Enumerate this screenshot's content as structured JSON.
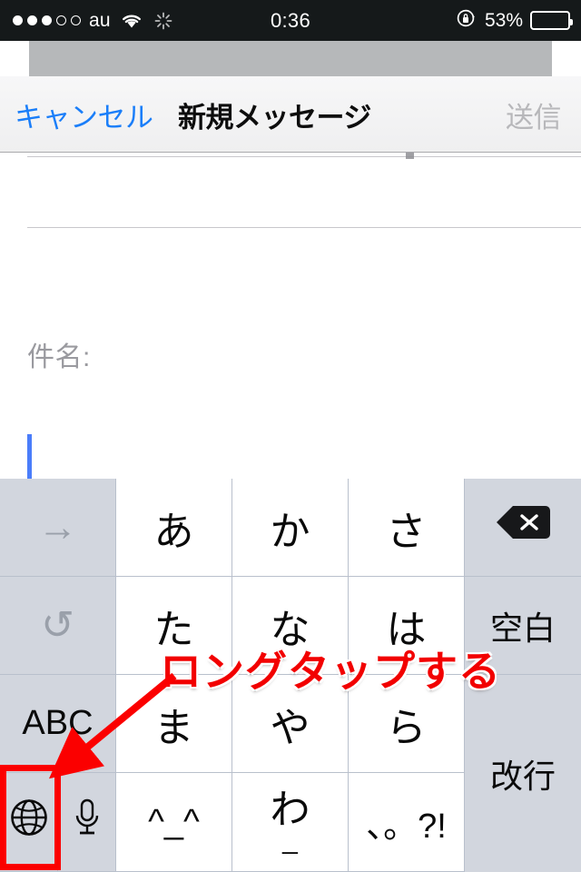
{
  "status_bar": {
    "signal_dots_total": 5,
    "signal_dots_filled": 3,
    "carrier": "au",
    "wifi_icon": "wifi-icon",
    "activity_icon": "activity-spinner-icon",
    "time": "0:36",
    "rotation_lock_icon": "rotation-lock-icon",
    "battery_percent": "53%",
    "battery_level": 53,
    "background_color": "#15191a",
    "text_color": "#ffffff"
  },
  "nav_bar": {
    "cancel_label": "キャンセル",
    "title": "新規メッセージ",
    "send_label": "送信",
    "cancel_color": "#1a7ef9",
    "send_color": "#b7b7ba"
  },
  "compose": {
    "subject_placeholder": "件名:",
    "body_value": "",
    "caret_color": "#4a7dfa"
  },
  "keyboard": {
    "type": "japanese-kana-12key",
    "rows": [
      [
        {
          "name": "next-candidate-key",
          "label": "→",
          "style": "fn-dim"
        },
        {
          "name": "key-a",
          "label": "あ",
          "style": "main"
        },
        {
          "name": "key-ka",
          "label": "か",
          "style": "main"
        },
        {
          "name": "key-sa",
          "label": "さ",
          "style": "main"
        },
        {
          "name": "delete-key",
          "label": "",
          "icon": "delete-backspace-icon",
          "style": "fn"
        }
      ],
      [
        {
          "name": "undo-key",
          "label": "↺",
          "style": "fn-dim"
        },
        {
          "name": "key-ta",
          "label": "た",
          "style": "main"
        },
        {
          "name": "key-na",
          "label": "な",
          "style": "main"
        },
        {
          "name": "key-ha",
          "label": "は",
          "style": "main"
        },
        {
          "name": "space-key",
          "label": "空白",
          "style": "fn"
        }
      ],
      [
        {
          "name": "abc-mode-key",
          "label": "ABC",
          "style": "fn"
        },
        {
          "name": "key-ma",
          "label": "ま",
          "style": "main"
        },
        {
          "name": "key-ya",
          "label": "や",
          "style": "main"
        },
        {
          "name": "key-ra",
          "label": "ら",
          "style": "main"
        },
        {
          "name": "return-key",
          "label": "改行",
          "style": "fn"
        }
      ],
      [
        {
          "name": "globe-key",
          "label": "",
          "icon": "globe-icon",
          "style": "fn"
        },
        {
          "name": "dictation-key",
          "label": "",
          "icon": "microphone-icon",
          "style": "fn"
        },
        {
          "name": "key-emoticon",
          "label": "^_^",
          "style": "main"
        },
        {
          "name": "key-wa",
          "label": "わ",
          "sub_label": "_",
          "style": "main"
        },
        {
          "name": "key-punctuation",
          "label": "、。?!",
          "style": "main"
        }
      ]
    ],
    "key_bg": "#ffffff",
    "fn_key_bg": "#d2d6de",
    "key_border_color": "#b9c0cc"
  },
  "annotation": {
    "text": "ロングタップする",
    "text_color": "#f20000",
    "outline_color": "#ffffff",
    "highlight_box_color": "#fb0000",
    "arrow_color": "#fb0000",
    "target": "globe-key"
  }
}
